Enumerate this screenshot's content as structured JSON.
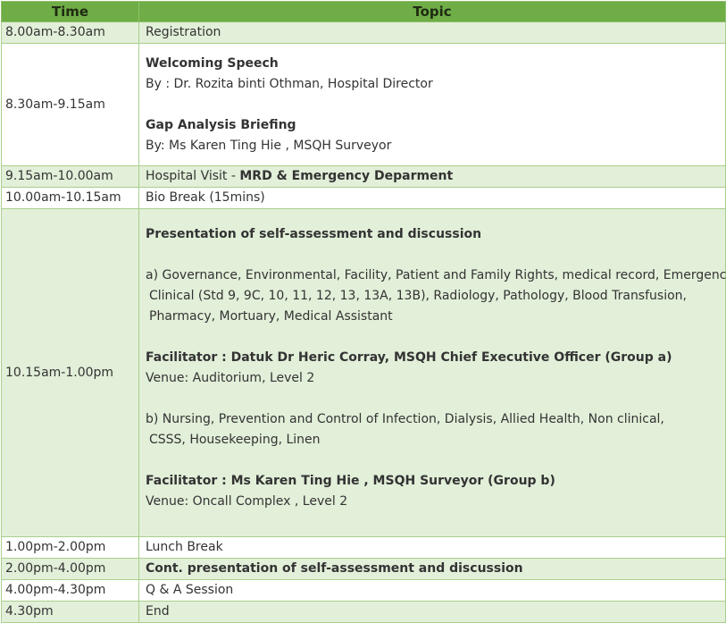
{
  "header": {
    "time": "Time",
    "topic": "Topic"
  },
  "rows": [
    {
      "time": "8.00am-8.30am",
      "topic": "Registration"
    },
    {
      "time": "8.30am-9.15am",
      "items": [
        {
          "title": "Welcoming Speech",
          "by": "By : Dr. Rozita binti Othman, Hospital Director"
        },
        {
          "title": "Gap Analysis Briefing",
          "by": "By: Ms Karen Ting Hie , MSQH Surveyor"
        }
      ]
    },
    {
      "time": "9.15am-10.00am",
      "topic_prefix": "Hospital Visit - ",
      "topic_bold": "MRD & Emergency Deparment"
    },
    {
      "time": "10.00am-10.15am",
      "topic": "Bio Break (15mins)"
    },
    {
      "time": "10.15am-1.00pm",
      "title": "Presentation of self-assessment and discussion",
      "group_a": {
        "line1": "a) Governance, Environmental, Facility, Patient and Family Rights, medical record, Emergency,",
        "line2": "Clinical (Std 9, 9C, 10, 11, 12, 13, 13A, 13B),  Radiology, Pathology, Blood Transfusion,",
        "line3": "Pharmacy, Mortuary, Medical Assistant",
        "facilitator_label": "Facilitator : ",
        "facilitator": "Datuk Dr Heric Corray, MSQH Chief Executive Officer (Group a)",
        "venue": "Venue:  Auditorium, Level 2"
      },
      "group_b": {
        "line1": "b) Nursing, Prevention and Control of Infection, Dialysis, Allied Health, Non clinical,",
        "line2": "CSSS, Housekeeping, Linen",
        "facilitator_label": "Facilitator : ",
        "facilitator": "Ms Karen Ting Hie , MSQH Surveyor (Group b)",
        "venue": "Venue: Oncall Complex , Level 2"
      }
    },
    {
      "time": "1.00pm-2.00pm",
      "topic": "Lunch Break"
    },
    {
      "time": "2.00pm-4.00pm",
      "topic_bold": "Cont. presentation of self-assessment and discussion"
    },
    {
      "time": "4.00pm-4.30pm",
      "topic": "Q & A Session"
    },
    {
      "time": "4.30pm",
      "topic": "End"
    }
  ],
  "colors": {
    "header_bg": "#6fad47",
    "row_green": "#e2efd9",
    "row_white": "#ffffff",
    "border": "#a9cf8c"
  }
}
